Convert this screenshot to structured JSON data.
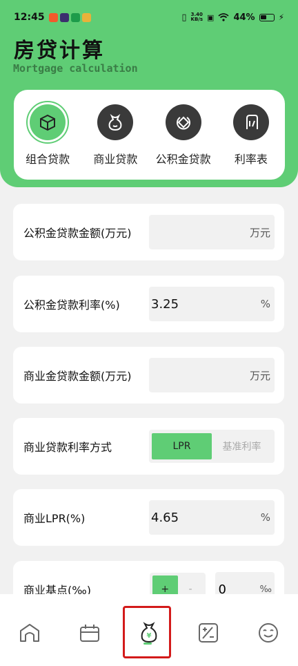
{
  "status_bar": {
    "time": "12:45",
    "speed_top": "3.40",
    "speed_bottom": "KB/s",
    "battery": "44%"
  },
  "header": {
    "title": "房贷计算",
    "subtitle": "Mortgage calculation"
  },
  "categories": [
    {
      "label": "组合贷款",
      "icon": "combo-loan-icon",
      "active": true
    },
    {
      "label": "商业贷款",
      "icon": "commercial-loan-icon",
      "active": false
    },
    {
      "label": "公积金贷款",
      "icon": "provident-fund-icon",
      "active": false
    },
    {
      "label": "利率表",
      "icon": "rate-table-icon",
      "active": false
    }
  ],
  "rows": {
    "pf_amount": {
      "label": "公积金贷款金额(万元)",
      "value": "",
      "unit": "万元"
    },
    "pf_rate": {
      "label": "公积金贷款利率(%)",
      "value": "3.25",
      "unit": "%"
    },
    "com_amount": {
      "label": "商业金贷款金额(万元)",
      "value": "",
      "unit": "万元"
    },
    "com_rate_mode": {
      "label": "商业贷款利率方式",
      "options": [
        "LPR",
        "基准利率"
      ],
      "selected": "LPR"
    },
    "com_lpr": {
      "label": "商业LPR(%)",
      "value": "4.65",
      "unit": "%"
    },
    "basis_point": {
      "label": "商业基点(‰)",
      "plus": "+",
      "minus": "-",
      "value": "0",
      "unit": "‰"
    }
  },
  "bottom_nav": [
    {
      "name": "home-icon"
    },
    {
      "name": "calendar-icon"
    },
    {
      "name": "money-bag-icon",
      "active": true
    },
    {
      "name": "calculator-icon"
    },
    {
      "name": "smile-icon"
    }
  ],
  "colors": {
    "accent": "#5fcd75",
    "highlight_box": "#d31a1a"
  }
}
